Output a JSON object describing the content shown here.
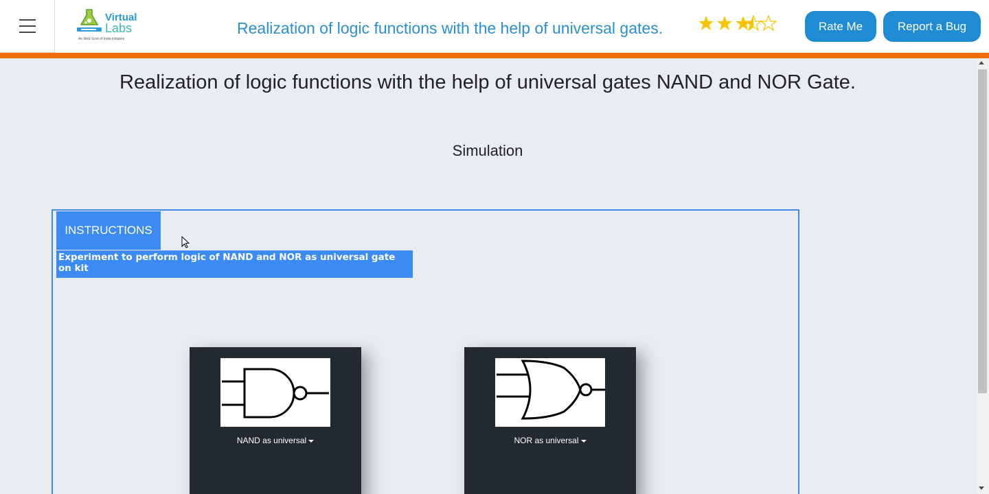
{
  "header": {
    "logo": {
      "line1": "Virtual",
      "line2": "Labs",
      "tagline": "An MoE Govt of India Initiative"
    },
    "title": "Realization of logic functions with the help of universal gates.",
    "rating": 3.5,
    "rate_label": "Rate Me",
    "bug_label": "Report a Bug"
  },
  "main": {
    "page_title": "Realization of logic functions with the help of universal gates NAND and NOR Gate.",
    "section_label": "Simulation",
    "instructions_label": "INSTRUCTIONS",
    "experiment_banner": "Experiment to perform logic of NAND and NOR as universal gate on kit",
    "cards": [
      {
        "label": "NAND as universal",
        "icon": "nand-gate-icon"
      },
      {
        "label": "NOR as universal",
        "icon": "nor-gate-icon"
      }
    ]
  },
  "colors": {
    "accent_orange": "#ef6c00",
    "button_blue": "#1f8bd2",
    "instructions_blue": "#3c8bf5",
    "card_dark": "#232a2f",
    "star_gold": "#f6c400"
  }
}
